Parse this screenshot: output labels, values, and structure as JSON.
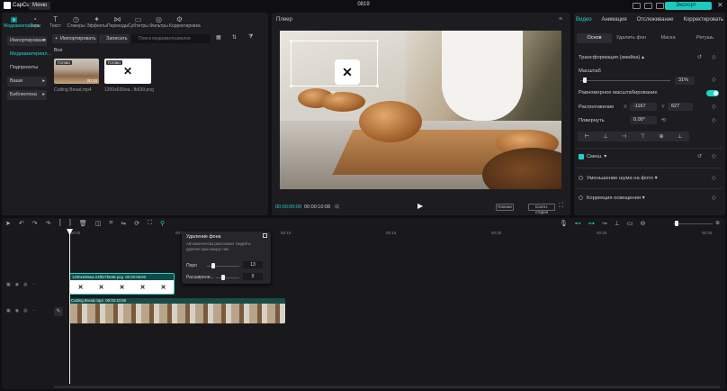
{
  "titlebar": {
    "app_name": "CapCut",
    "menu_label": "Меню",
    "project_title": "0819",
    "export_label": "Экспорт"
  },
  "tabs": [
    {
      "label": "Медиаматериалы",
      "icon": "media-icon"
    },
    {
      "label": "Звук",
      "icon": "music-icon"
    },
    {
      "label": "Текст",
      "icon": "text-icon"
    },
    {
      "label": "Стикеры",
      "icon": "sticker-icon"
    },
    {
      "label": "Эффекты",
      "icon": "effects-icon"
    },
    {
      "label": "Переходы",
      "icon": "transition-icon"
    },
    {
      "label": "Субтитры",
      "icon": "subtitles-icon"
    },
    {
      "label": "Фильтры",
      "icon": "filter-icon"
    },
    {
      "label": "Корректировка",
      "icon": "adjust-icon"
    }
  ],
  "sidebar": {
    "items": [
      "Импортировано",
      "Медиаматериал...",
      "Подпроекты",
      "Ваши",
      "Библиотека"
    ]
  },
  "media": {
    "import_label": "Импортировать",
    "record_label": "Записать",
    "search_placeholder": "Поиск медиаматериалов",
    "all_label": "Все",
    "items": [
      {
        "badge": "Готово",
        "duration": "00:10",
        "name": "Cutting Bread.mp4"
      },
      {
        "badge": "Готово",
        "duration": "",
        "name": "1200x630wa...fb639.png"
      }
    ]
  },
  "player": {
    "title": "Плеер",
    "time_current": "00:00:00:00",
    "time_total": "00:00:10:08",
    "btn_original": "Полное",
    "btn_ratio": "Соотн. сторон"
  },
  "right": {
    "tabs": [
      "Видео",
      "Анимация",
      "Отслеживание",
      "Корректировать"
    ],
    "subtabs": [
      "Основ",
      "Удалить фон",
      "Маска",
      "Ретушь"
    ],
    "transform_label": "Трансформация (змейка)",
    "scale_label": "Масштаб",
    "scale_value": "31%",
    "uniform_label": "Равномерное масштабирование",
    "position_label": "Расположение",
    "pos_x_label": "X",
    "pos_x": "-1167",
    "pos_y_label": "Y",
    "pos_y": "627",
    "rotate_label": "Повернуть",
    "rotate_value": "0.00°",
    "blend_label": "Смеш.",
    "noise_label": "Уменьшение шума на фото",
    "light_label": "Коррекция освещения"
  },
  "timeline": {
    "ruler": [
      "00:00",
      "00:05",
      "00:10",
      "00:15",
      "00:20",
      "00:25",
      "00:30"
    ],
    "clip_overlay_name": "1200x630wa-24f027b639.png",
    "clip_overlay_time": "00:00:05:00",
    "clip_main_name": "Cutting Bread.mp4",
    "clip_main_time": "00:00:10:08"
  },
  "popup": {
    "title": "Удаление фона",
    "desc": "Автоматически распознает людей и удаляет фон вокруг них.",
    "feather_label": "Перо",
    "feather_value": "13",
    "feather_level": 0.2,
    "expand_label": "Расширени...",
    "expand_value": "0",
    "expand_level": 0.3
  },
  "colors": {
    "accent": "#21d1c8",
    "panel": "#1d1d21"
  }
}
